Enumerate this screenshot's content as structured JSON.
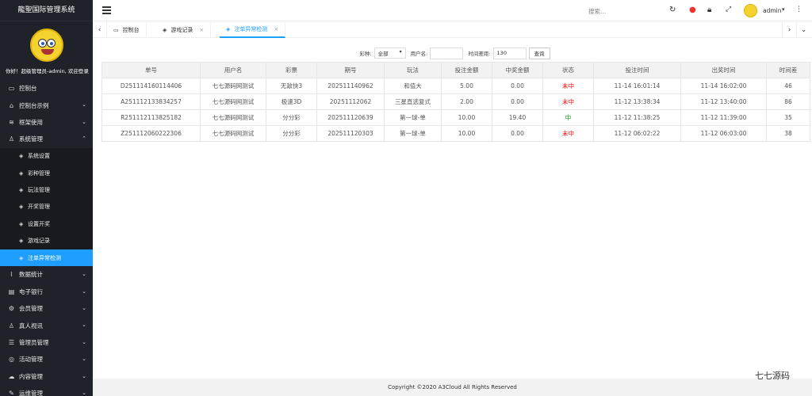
{
  "brand": "龍聖国际管理系统",
  "welcome": "你好！超级管理员-admin, 欢迎登录",
  "nav": [
    {
      "label": "控制台",
      "icon": "monitor-icon",
      "chevron": false
    },
    {
      "label": "控制台示例",
      "icon": "home-icon",
      "chevron": true
    },
    {
      "label": "框架使用",
      "icon": "layers-icon",
      "chevron": true
    },
    {
      "label": "系统管理",
      "icon": "user-icon",
      "chevron": true
    }
  ],
  "subnav": [
    {
      "label": "系统设置"
    },
    {
      "label": "彩种管理"
    },
    {
      "label": "玩法管理"
    },
    {
      "label": "开奖管理"
    },
    {
      "label": "设置开奖"
    },
    {
      "label": "游戏记录"
    },
    {
      "label": "注单异常检测"
    }
  ],
  "nav2": [
    {
      "label": "数据统计",
      "icon": "chart-icon"
    },
    {
      "label": "电子银行",
      "icon": "bank-icon"
    },
    {
      "label": "会员管理",
      "icon": "settings-icon"
    },
    {
      "label": "真人视讯",
      "icon": "person-icon"
    },
    {
      "label": "管理员管理",
      "icon": "list-icon"
    },
    {
      "label": "活动管理",
      "icon": "globe-icon"
    },
    {
      "label": "内容管理",
      "icon": "cloud-icon"
    },
    {
      "label": "运维管理",
      "icon": "tools-icon"
    }
  ],
  "topbar": {
    "search": "搜索...",
    "user": "admin"
  },
  "tabs": [
    {
      "label": "控制台",
      "icon": "monitor-icon"
    },
    {
      "label": "游戏记录",
      "icon": "layers-icon"
    },
    {
      "label": "注单异常检测",
      "icon": "layers-icon"
    }
  ],
  "filter": {
    "lottery_label": "彩种:",
    "lottery_value": "全部",
    "user_label": "用户名:",
    "user_value": "",
    "diff_label": "时间差距:",
    "diff_value": "130",
    "query_btn": "查询"
  },
  "table": {
    "headers": [
      "单号",
      "用户名",
      "彩票",
      "期号",
      "玩法",
      "投注金额",
      "中奖金额",
      "状态",
      "投注时间",
      "出奖时间",
      "时间差"
    ],
    "rows": [
      [
        "D251114160114406",
        "七七源码网测试",
        "无敌快3",
        "202511140962",
        "和值大",
        "5.00",
        "0.00",
        "未中",
        "11-14 16:01:14",
        "11-14 16:02:00",
        "46"
      ],
      [
        "A251112133834257",
        "七七源码网测试",
        "极速3D",
        "20251112062",
        "三星直选复式",
        "2.00",
        "0.00",
        "未中",
        "11-12 13:38:34",
        "11-12 13:40:00",
        "86"
      ],
      [
        "R251112113825182",
        "七七源码网测试",
        "分分彩",
        "202511120639",
        "第一球-单",
        "10.00",
        "19.40",
        "中",
        "11-12 11:38:25",
        "11-12 11:39:00",
        "35"
      ],
      [
        "Z251112060222306",
        "七七源码网测试",
        "分分彩",
        "202511120303",
        "第一球-单",
        "10.00",
        "0.00",
        "未中",
        "11-12 06:02:22",
        "11-12 06:03:00",
        "38"
      ]
    ]
  },
  "footer": "Copyright ©2020 A3Cloud All Rights Reserved",
  "watermark": {
    "logo": "七七源码"
  }
}
